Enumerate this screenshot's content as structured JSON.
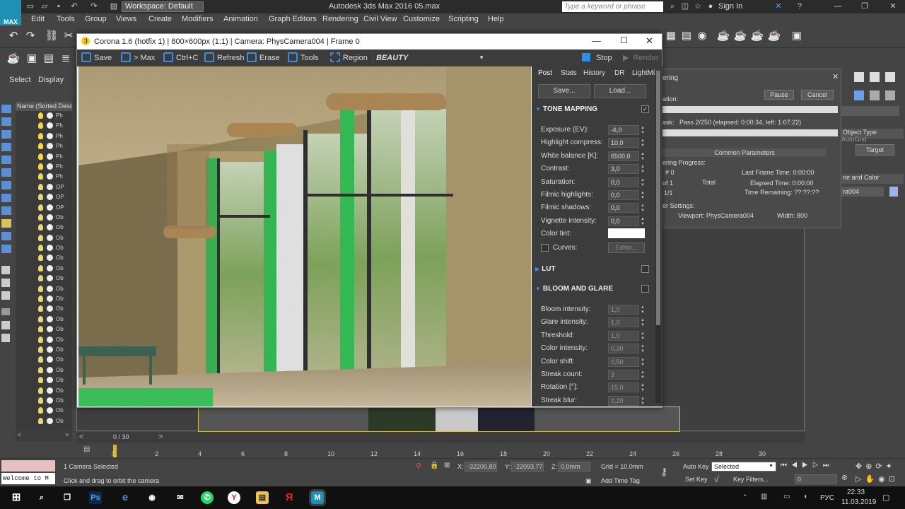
{
  "titlebar": {
    "workspace": "Workspace: Default",
    "app_title": "Autodesk 3ds Max 2016     05.max",
    "search_placeholder": "Type a keyword or phrase",
    "signin": "Sign In"
  },
  "menu": [
    "Edit",
    "Tools",
    "Group",
    "Views",
    "Create",
    "Modifiers",
    "Animation",
    "Graph Editors",
    "Rendering",
    "Civil View",
    "Customize",
    "Scripting",
    "Help"
  ],
  "left_panel": {
    "tabs": [
      "Select",
      "Display"
    ],
    "list_header": "Name (Sorted Descending)",
    "rows": [
      "Ph",
      "Ph",
      "Ph",
      "Ph",
      "Ph",
      "Ph",
      "Ph",
      "OP",
      "OP",
      "OP",
      "Ob",
      "Ob",
      "Ob",
      "Ob",
      "Ob",
      "Ob",
      "Ob",
      "Ob",
      "Ob",
      "Ob",
      "Ob",
      "Ob",
      "Ob",
      "Ob",
      "Ob",
      "Ob",
      "Ob",
      "Ob",
      "Ob",
      "Ob",
      "Ob"
    ]
  },
  "vfb": {
    "title": "Corona 1.6 (hotfix 1) | 800×600px (1:1) | Camera: PhysCamera004 | Frame 0",
    "toolbar": {
      "save": "Save",
      "to_max": "> Max",
      "ctrl_c": "Ctrl+C",
      "refresh": "Refresh",
      "erase": "Erase",
      "tools": "Tools",
      "region": "Region",
      "channel": "BEAUTY",
      "stop": "Stop",
      "render": "Render"
    },
    "tabs": [
      "Post",
      "Stats",
      "History",
      "DR",
      "LightMix"
    ],
    "save_btn": "Save...",
    "load_btn": "Load...",
    "sections": {
      "tone_mapping": "TONE MAPPING",
      "lut": "LUT",
      "bloom": "BLOOM AND GLARE"
    },
    "tone_params": [
      {
        "label": "Exposure (EV):",
        "value": "-6,0"
      },
      {
        "label": "Highlight compress:",
        "value": "10,0"
      },
      {
        "label": "White balance [K]:",
        "value": "6500,0"
      },
      {
        "label": "Contrast:",
        "value": "3,0"
      },
      {
        "label": "Saturation:",
        "value": "0,0"
      },
      {
        "label": "Filmic highlights:",
        "value": "0,0"
      },
      {
        "label": "Filmic shadows:",
        "value": "0,0"
      },
      {
        "label": "Vignette intensity:",
        "value": "0,0"
      }
    ],
    "color_tint_label": "Color tint:",
    "curves_label": "Curves:",
    "editor_btn": "Editor...",
    "bloom_params": [
      {
        "label": "Bloom intensity:",
        "value": "1,0"
      },
      {
        "label": "Glare intensity:",
        "value": "1,0"
      },
      {
        "label": "Threshold:",
        "value": "1,0"
      },
      {
        "label": "Color intensity:",
        "value": "0,30"
      },
      {
        "label": "Color shift:",
        "value": "0,50"
      },
      {
        "label": "Streak count:",
        "value": "3"
      },
      {
        "label": "Rotation [°]:",
        "value": "15,0"
      },
      {
        "label": "Streak blur:",
        "value": "0,20"
      }
    ]
  },
  "render_dialog": {
    "title": "ering",
    "operation": "ation:",
    "pause": "Pause",
    "cancel": "Cancel",
    "task_label": "ask:",
    "task": "Pass 2/250 (elapsed: 0:00:34, left: 1:07:22)",
    "common_params": "Common Parameters",
    "progress": "ering Progress:",
    "frame_hash": "# 0",
    "of": "of 1",
    "total": "Total",
    "frac": "1/1",
    "last_frame": "Last Frame Time: 0:00:00",
    "elapsed": "Elapsed Time: 0:00:00",
    "remaining": "Time Remaining: ??:??:??",
    "settings": "er Settings:",
    "viewport": "Viewport: PhysCamera004",
    "width": "Width: 800"
  },
  "command_panel": {
    "object_type": "Object Type",
    "autogrid": "AutoGrid",
    "target": "Target",
    "name_color": "ne and Color",
    "name_value": "ra004"
  },
  "timeline": {
    "frame": "0 / 30",
    "ticks": [
      "0",
      "2",
      "4",
      "6",
      "8",
      "10",
      "12",
      "14",
      "16",
      "18",
      "20",
      "22",
      "24",
      "26",
      "28",
      "30"
    ]
  },
  "status": {
    "welcome": "Welcome to M",
    "selection": "1 Camera Selected",
    "prompt": "Click and drag to orbit the camera",
    "x_label": "X:",
    "x": "-32200,80",
    "y_label": "Y:",
    "y": "-22093,77",
    "z_label": "Z:",
    "z": "0,0mm",
    "grid": "Grid = 10,0mm",
    "add_time_tag": "Add Time Tag",
    "auto_key": "Auto Key",
    "set_key": "Set Key",
    "selected": "Selected",
    "key_filters": "Key Filters...",
    "frame_field": "0"
  },
  "taskbar": {
    "lang": "РУС",
    "time": "22:33",
    "date": "11.03.2019"
  }
}
